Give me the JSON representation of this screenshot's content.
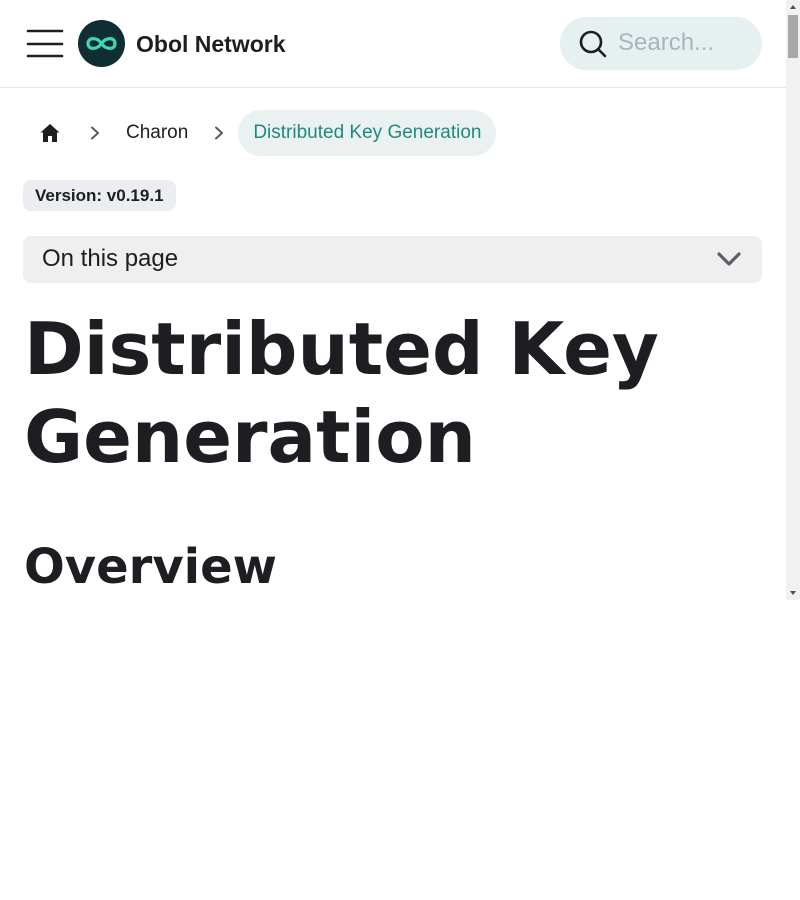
{
  "navbar": {
    "brand": "Obol Network",
    "menu_icon": "hamburger-menu-icon",
    "logo_icon": "infinity-logo-icon",
    "search": {
      "icon": "search-icon",
      "placeholder": "Search...",
      "value": ""
    }
  },
  "breadcrumbs": {
    "home_icon": "home-icon",
    "separator_icon": "chevron-right-icon",
    "items": [
      {
        "label": "Charon"
      },
      {
        "label": "Distributed Key Generation"
      }
    ]
  },
  "version_badge": "Version: v0.19.1",
  "toc": {
    "label": "On this page",
    "icon": "chevron-down-icon"
  },
  "content": {
    "title": "Distributed Key Generation",
    "section_heading": "Overview"
  },
  "colors": {
    "accent": "#1f8a7e",
    "logo_bg": "#0f2d33",
    "logo_stroke": "#3fd7b0",
    "search_bg": "#e6f0f0",
    "breadcrumb_active_bg": "#ebf1f1",
    "badge_bg": "#ebedf0",
    "toc_bg": "#efefef",
    "text": "#1c1e21"
  }
}
